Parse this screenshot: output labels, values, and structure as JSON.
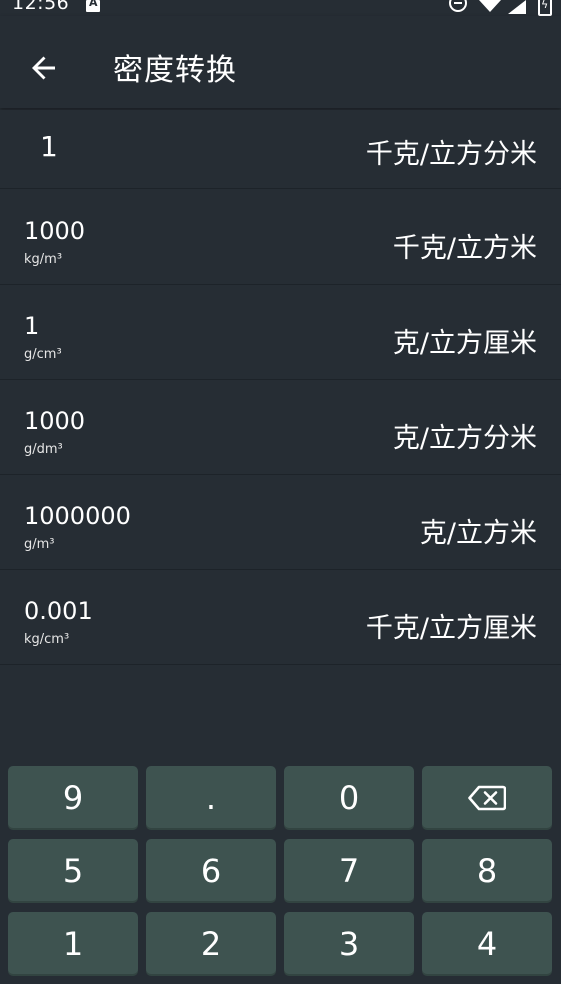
{
  "status_bar": {
    "time": "12:56"
  },
  "header": {
    "title": "密度转换",
    "back_icon": "arrow-left-icon"
  },
  "input": {
    "value": "1",
    "unit": "千克/立方分米"
  },
  "results": [
    {
      "value": "1000",
      "symbol": "kg/m³",
      "unit": "千克/立方米"
    },
    {
      "value": "1",
      "symbol": "g/cm³",
      "unit": "克/立方厘米"
    },
    {
      "value": "1000",
      "symbol": "g/dm³",
      "unit": "克/立方分米"
    },
    {
      "value": "1000000",
      "symbol": "g/m³",
      "unit": "克/立方米"
    },
    {
      "value": "0.001",
      "symbol": "kg/cm³",
      "unit": "千克/立方厘米"
    }
  ],
  "keypad": {
    "rows": [
      [
        "9",
        ".",
        "0",
        "backspace"
      ],
      [
        "5",
        "6",
        "7",
        "8"
      ],
      [
        "1",
        "2",
        "3",
        "4"
      ]
    ]
  },
  "colors": {
    "background": "#262d34",
    "key": "#3e5350"
  }
}
